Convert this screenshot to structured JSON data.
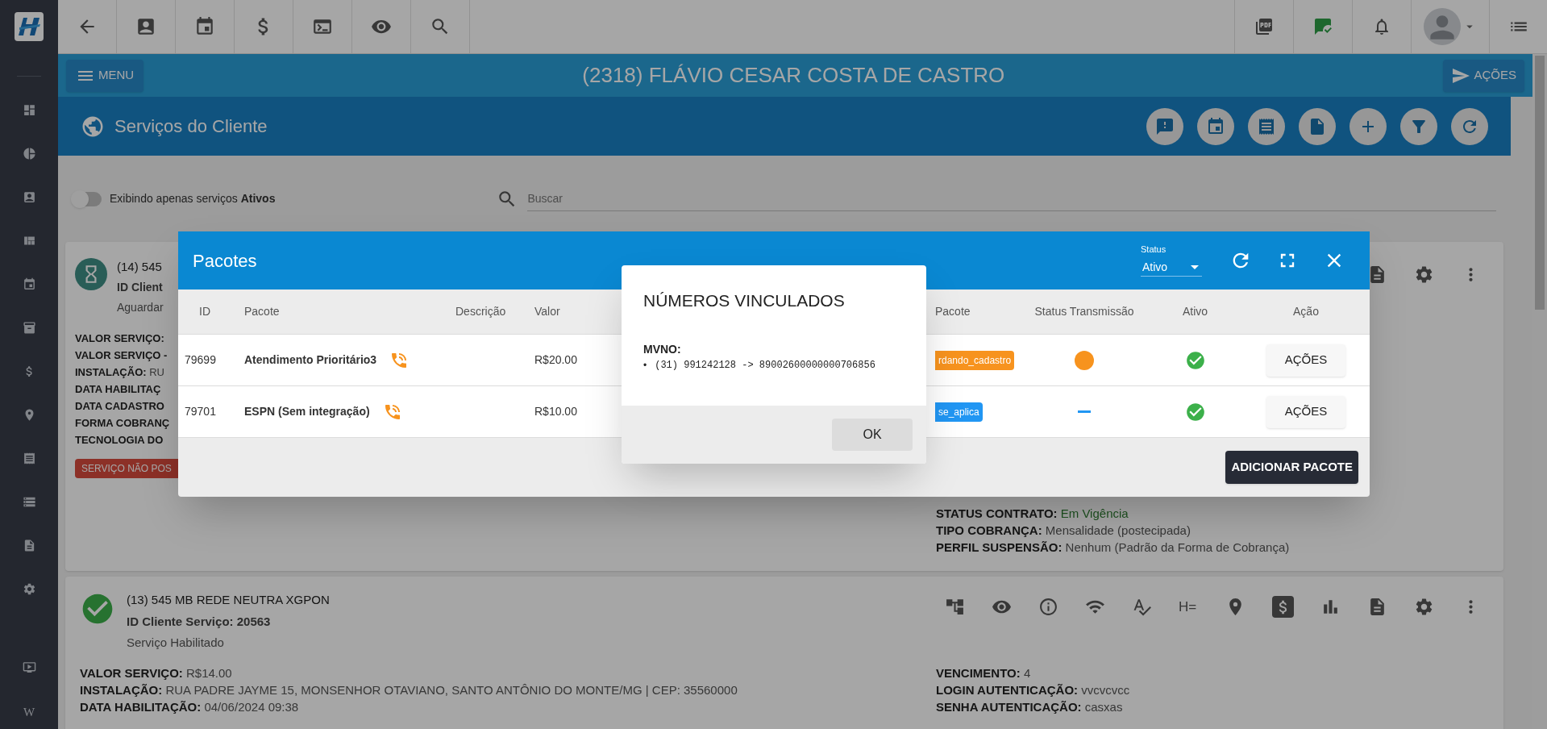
{
  "sidebar": {
    "footer_glyph": "W"
  },
  "header": {
    "menu_button": "MENU",
    "title": "(2318) FLÁVIO CESAR COSTA DE CASTRO",
    "actions_button": "AÇÕES"
  },
  "section": {
    "title": "Serviços do Cliente"
  },
  "filter": {
    "toggle": {
      "label": "Exibindo apenas serviços **Ativos**",
      "on": false
    },
    "search": {
      "placeholder": "Buscar"
    }
  },
  "services": [
    {
      "kind": "pending",
      "title": "(14) 545",
      "client_id": "ID Client",
      "status": "Aguardar",
      "details_left": [
        {
          "label": "VALOR SERVIÇO:"
        },
        {
          "label": "VALOR SERVIÇO -"
        },
        {
          "label": "INSTALAÇÃO:",
          "value": "RU"
        },
        {
          "label": "DATA HABILITAÇ"
        },
        {
          "label": "DATA CADASTRO"
        },
        {
          "label": "FORMA COBRANÇ"
        },
        {
          "label": "TECNOLOGIA DO"
        }
      ],
      "badge": "SERVIÇO NÃO POS",
      "details_right": [
        {
          "label": "STATUS CONTRATO:",
          "value": "Em Vigência",
          "highlight": true
        },
        {
          "label": "TIPO COBRANÇA:",
          "value": "Mensalidade (postecipada)",
          "highlight": false
        },
        {
          "label": "PERFIL SUSPENSÃO:",
          "value": "Nenhum (Padrão da Forma de Cobrança)",
          "highlight": false
        }
      ]
    },
    {
      "kind": "enabled",
      "title": "(13) 545 MB REDE NEUTRA XGPON",
      "client_id": "ID Cliente Serviço: 20563",
      "status": "Serviço Habilitado",
      "tool_glyph": "H=",
      "details_left": [
        {
          "label": "VALOR SERVIÇO:",
          "value": "R$14.00"
        },
        {
          "label": "INSTALAÇÃO:",
          "value": "RUA PADRE JAYME 15, MONSENHOR OTAVIANO, SANTO ANTÔNIO DO MONTE/MG | CEP: 35560000"
        },
        {
          "label": "DATA HABILITAÇÃO:",
          "value": "04/06/2024 09:38"
        }
      ],
      "details_right": [
        {
          "label": "VENCIMENTO:",
          "value": "4",
          "highlight": false
        },
        {
          "label": "LOGIN AUTENTICAÇÃO:",
          "value": "vvcvcvcc",
          "highlight": false
        },
        {
          "label": "SENHA AUTENTICAÇÃO:",
          "value": "casxas",
          "highlight": false
        }
      ]
    }
  ],
  "pacotes": {
    "title": "Pacotes",
    "status_select": {
      "label": "Status",
      "value": "Ativo"
    },
    "columns": [
      "ID",
      "Pacote",
      "Descrição",
      "Valor",
      "Pacote",
      "Status Transmissão",
      "Ativo",
      "Ação"
    ],
    "rows": [
      {
        "id": "79699",
        "name": "Atendimento Prioritário3",
        "value": "R$20.00",
        "package_status": {
          "text": "rdando_cadastro",
          "color": "#f7931e"
        },
        "transmission": {
          "kind": "pending"
        },
        "active": true,
        "action": "AÇÕES"
      },
      {
        "id": "79701",
        "name": "ESPN (Sem integração)",
        "value": "R$10.00",
        "package_status": {
          "text": "se_aplica",
          "color": "#2196f3"
        },
        "transmission": {
          "kind": "none"
        },
        "active": true,
        "action": "AÇÕES"
      }
    ],
    "add_button": "ADICIONAR PACOTE"
  },
  "dialog": {
    "title": "NÚMEROS VINCULADOS",
    "group_label": "MVNO:",
    "bullet": "•",
    "items": [
      "(31) 991242128 -> 89002600000000706856"
    ],
    "ok_button": "OK"
  }
}
